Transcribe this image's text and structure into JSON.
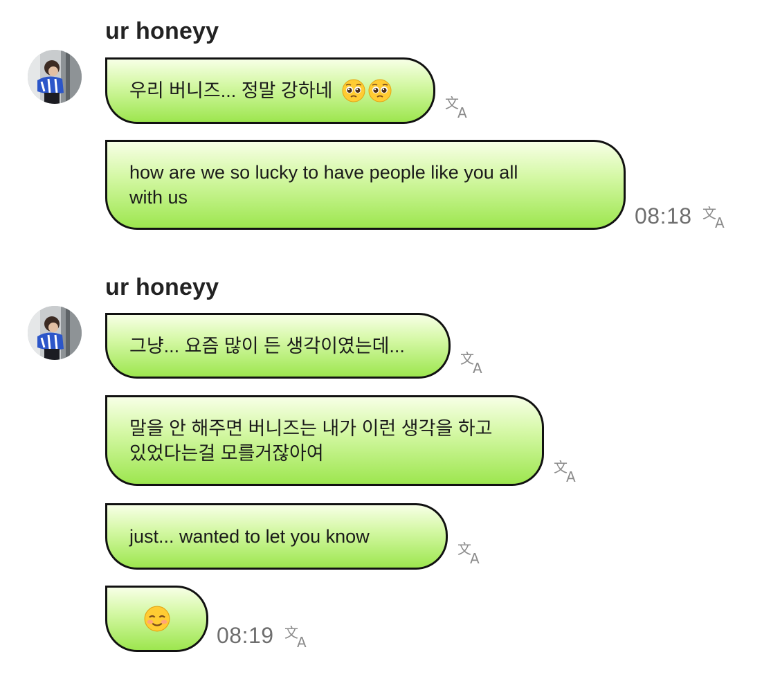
{
  "groups": [
    {
      "sender": "ur honeyy",
      "messages": [
        {
          "text": "우리 버니즈... 정말 강하네",
          "emoji": [
            "pleading-face",
            "pleading-face"
          ],
          "time": ""
        },
        {
          "text": "how are we so lucky to have people like you all\nwith us",
          "time": "08:18"
        }
      ]
    },
    {
      "sender": "ur honeyy",
      "messages": [
        {
          "text": "그냥... 요즘 많이 든 생각이였는데...",
          "time": ""
        },
        {
          "text": "말을 안 해주면 버니즈는 내가 이런 생각을 하고\n있었다는걸 모를거잖아여",
          "time": ""
        },
        {
          "text": "just... wanted to let you know",
          "time": ""
        },
        {
          "text": "",
          "emoji": [
            "smiling-face"
          ],
          "time": "08:19"
        }
      ]
    }
  ],
  "colors": {
    "bubble_top": "#f7ffe6",
    "bubble_bottom": "#9de64f",
    "bubble_border": "#111111",
    "time_text": "#6e6e6e"
  },
  "icons": {
    "translate": "translate-icon"
  }
}
